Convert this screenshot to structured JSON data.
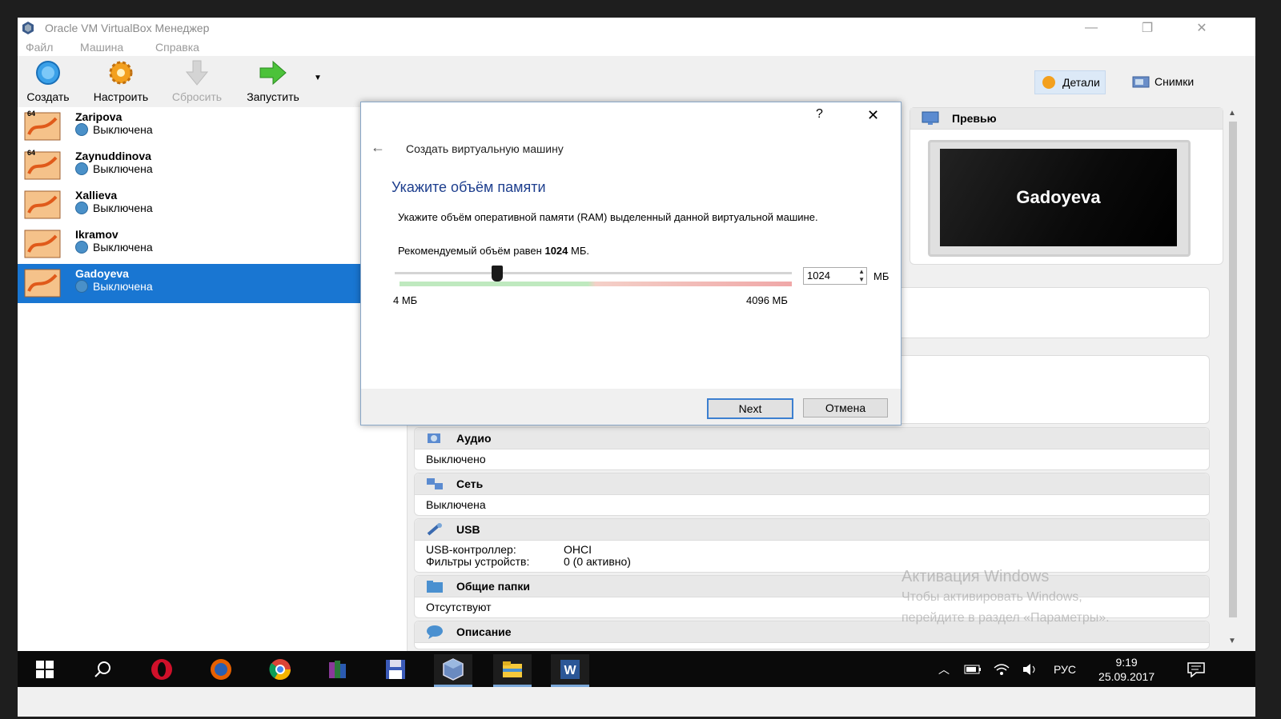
{
  "window": {
    "title": "Oracle VM VirtualBox Менеджер"
  },
  "menu": [
    "Файл",
    "Машина",
    "Справка"
  ],
  "toolbar": {
    "create": "Создать",
    "settings": "Настроить",
    "discard": "Сбросить",
    "start": "Запустить",
    "details": "Детали",
    "snapshots": "Снимки"
  },
  "vms": [
    {
      "name": "Zaripova",
      "state": "Выключена",
      "badge": "64"
    },
    {
      "name": "Zaynuddinova",
      "state": "Выключена",
      "badge": "64"
    },
    {
      "name": "Xallieva",
      "state": "Выключена",
      "badge": ""
    },
    {
      "name": "Ikramov",
      "state": "Выключена",
      "badge": ""
    },
    {
      "name": "Gadoyeva",
      "state": "Выключена",
      "badge": ""
    }
  ],
  "preview": {
    "title": "Превью",
    "vm_name": "Gadoyeva"
  },
  "sections": {
    "audio": {
      "title": "Аудио",
      "value": "Выключено"
    },
    "network": {
      "title": "Сеть",
      "value": "Выключена"
    },
    "usb": {
      "title": "USB",
      "controller_label": "USB-контроллер:",
      "controller_value": "OHCI",
      "filters_label": "Фильтры устройств:",
      "filters_value": "0 (0 активно)"
    },
    "shared": {
      "title": "Общие папки",
      "value": "Отсутствуют"
    },
    "description": {
      "title": "Описание"
    }
  },
  "watermark": {
    "line1": "Активация Windows",
    "line2": "Чтобы активировать Windows,",
    "line3": "перейдите в раздел «Параметры»."
  },
  "dialog": {
    "help": "?",
    "close": "✕",
    "breadcrumb": "Создать виртуальную машину",
    "heading": "Укажите объём памяти",
    "description": "Укажите объём оперативной памяти (RAM) выделенный данной виртуальной машине.",
    "recommended_prefix": "Рекомендуемый объём равен",
    "recommended_value": "1024",
    "recommended_suffix": "МБ.",
    "memory_value": "1024",
    "memory_unit": "МБ",
    "slider_min_label": "4 МБ",
    "slider_max_label": "4096 МБ",
    "slider_fraction": 0.25,
    "next": "Next",
    "cancel": "Отмена"
  },
  "taskbar": {
    "lang": "РУС",
    "time": "9:19",
    "date": "25.09.2017"
  }
}
